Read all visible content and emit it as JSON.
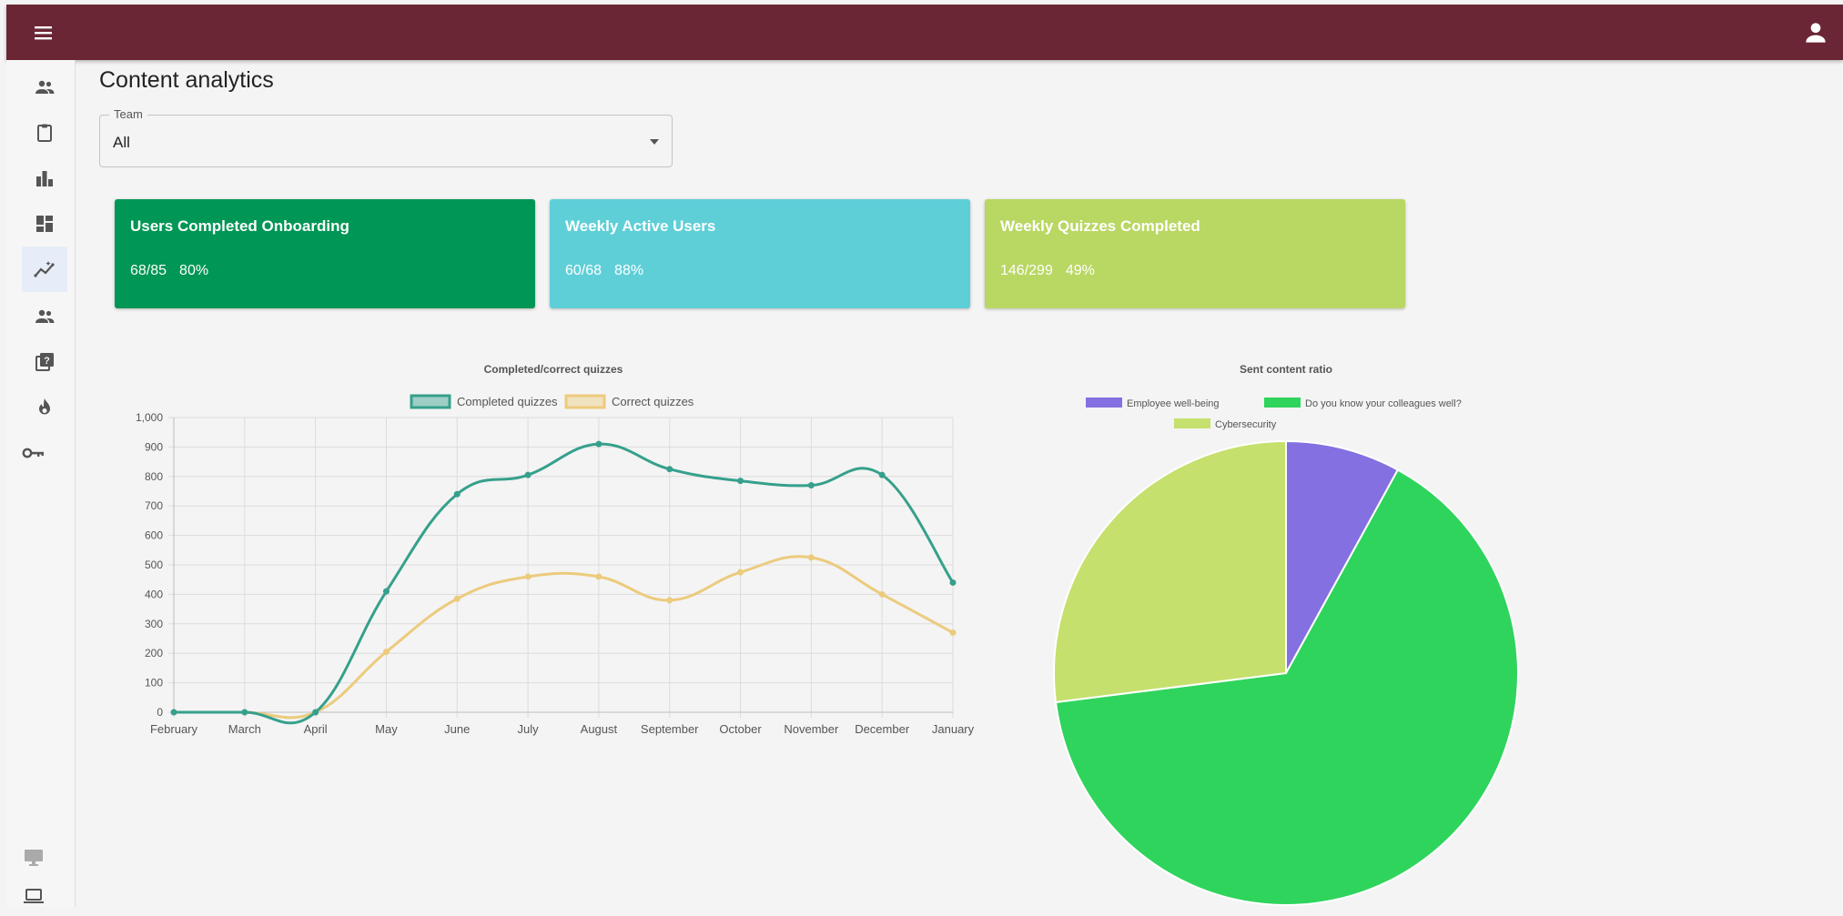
{
  "app": {
    "header": {
      "menu_icon": "hamburger-menu-icon",
      "user_icon": "account-icon",
      "color": "#6b2636"
    },
    "sidebar": {
      "items": [
        {
          "icon": "people-icon",
          "active": false
        },
        {
          "icon": "clipboard-icon",
          "active": false
        },
        {
          "icon": "bar-chart-icon",
          "active": false
        },
        {
          "icon": "dashboard-icon",
          "active": false
        },
        {
          "icon": "insights-icon",
          "active": true
        },
        {
          "icon": "group-icon",
          "active": false
        },
        {
          "icon": "quiz-icon",
          "active": false
        },
        {
          "icon": "fire-icon",
          "active": false
        },
        {
          "icon": "key-icon",
          "active": false
        },
        {
          "icon": "monitor-icon",
          "active": false
        },
        {
          "icon": "laptop-icon",
          "active": false
        }
      ]
    }
  },
  "page": {
    "title": "Content analytics"
  },
  "team_filter": {
    "label": "Team",
    "value": "All"
  },
  "stats": [
    {
      "title": "Users Completed Onboarding",
      "count": "68/85",
      "percent": "80%",
      "color": "#009655"
    },
    {
      "title": "Weekly Active Users",
      "count": "60/68",
      "percent": "88%",
      "color": "#5fcfd7"
    },
    {
      "title": "Weekly Quizzes Completed",
      "count": "146/299",
      "percent": "49%",
      "color": "#b9d763"
    }
  ],
  "chart_data": [
    {
      "type": "line",
      "title": "Completed/correct quizzes",
      "categories": [
        "February",
        "March",
        "April",
        "May",
        "June",
        "July",
        "August",
        "September",
        "October",
        "November",
        "December",
        "January"
      ],
      "ylim": [
        0,
        1000
      ],
      "yticks": [
        "0",
        "100",
        "200",
        "300",
        "400",
        "500",
        "600",
        "700",
        "800",
        "900",
        "1,000"
      ],
      "grid": true,
      "legend_position": "top",
      "series": [
        {
          "name": "Completed quizzes",
          "color": "#36a08c",
          "values": [
            0,
            0,
            0,
            410,
            740,
            805,
            910,
            825,
            785,
            770,
            805,
            440
          ]
        },
        {
          "name": "Correct quizzes",
          "color": "#eccb7d",
          "values": [
            0,
            0,
            0,
            205,
            385,
            460,
            460,
            380,
            475,
            525,
            400,
            270
          ]
        }
      ]
    },
    {
      "type": "pie",
      "title": "Sent content ratio",
      "legend_position": "top",
      "slices": [
        {
          "label": "Employee well-being",
          "value": 8,
          "color": "#8470e0"
        },
        {
          "label": "Do you know your colleagues well?",
          "value": 65,
          "color": "#2fd45c"
        },
        {
          "label": "Cybersecurity",
          "value": 27,
          "color": "#c5e06d"
        }
      ]
    }
  ]
}
